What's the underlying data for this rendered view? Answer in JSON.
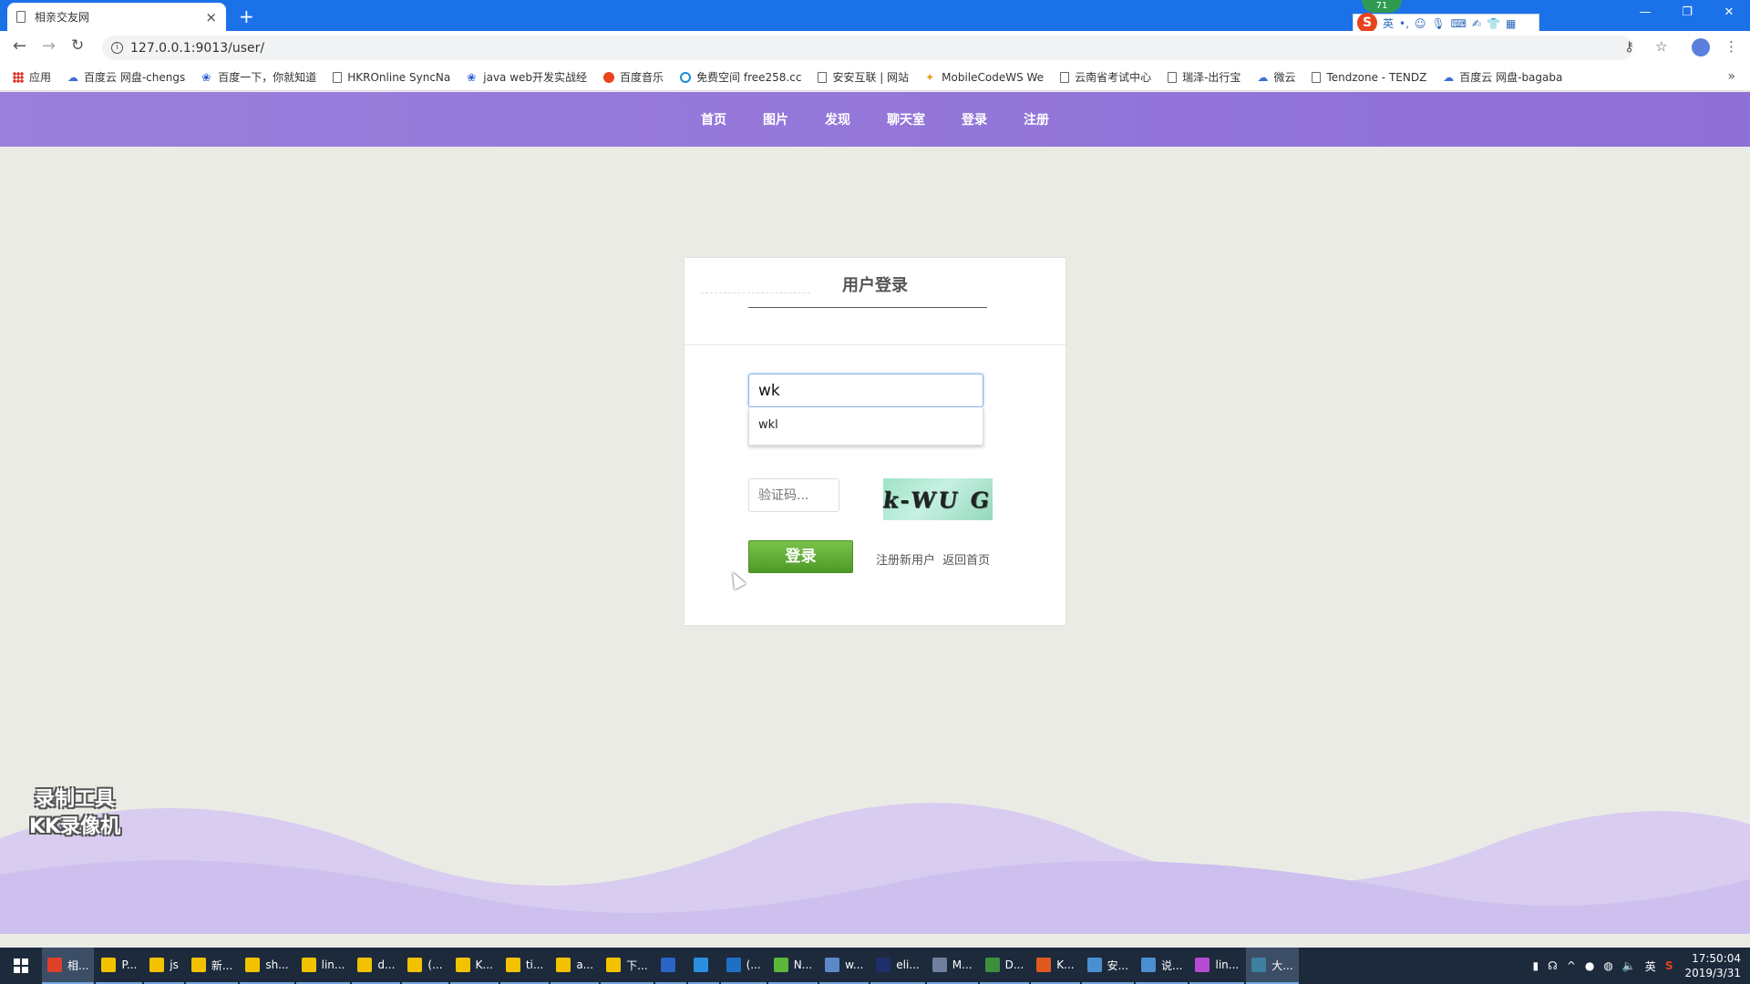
{
  "browser": {
    "tab_title": "相亲交友网",
    "tab_close": "×",
    "new_tab": "+",
    "window_controls": [
      "—",
      "❐",
      "✕"
    ],
    "url": "127.0.0.1:9013/user/",
    "ime_badge": "71",
    "ime_label": "英"
  },
  "bookmarks": [
    {
      "label": "应用",
      "icon": "apps-icon"
    },
    {
      "label": "百度云 网盘-chengs",
      "icon": "cloud-icon"
    },
    {
      "label": "百度一下，你就知道",
      "icon": "paw-icon"
    },
    {
      "label": "HKROnline SyncNa",
      "icon": "doc-icon"
    },
    {
      "label": "java web开发实战经",
      "icon": "paw-icon"
    },
    {
      "label": "百度音乐",
      "icon": "music-icon"
    },
    {
      "label": "免费空间 free258.cc",
      "icon": "globe-icon"
    },
    {
      "label": "安安互联 | 网站",
      "icon": "doc-icon"
    },
    {
      "label": "MobileCodeWS We",
      "icon": "star-icon"
    },
    {
      "label": "云南省考试中心",
      "icon": "doc-icon"
    },
    {
      "label": "瑞泽-出行宝",
      "icon": "doc-icon"
    },
    {
      "label": "微云",
      "icon": "cloud-icon"
    },
    {
      "label": "Tendzone - TENDZ",
      "icon": "doc-icon"
    },
    {
      "label": "百度云 网盘-bagaba",
      "icon": "cloud-icon"
    }
  ],
  "bookmarks_more": "»",
  "site_nav": [
    "首页",
    "图片",
    "发现",
    "聊天室",
    "登录",
    "注册"
  ],
  "login": {
    "title": "用户登录",
    "username_value": "wk",
    "suggestion": "wkl",
    "captcha_placeholder": "验证码...",
    "captcha_text": "k-WU G",
    "submit_label": "登录",
    "register_link": "注册新用户",
    "home_link": "返回首页"
  },
  "watermark": [
    "录制工具",
    "KK录像机"
  ],
  "taskbar": {
    "items": [
      {
        "label": "相...",
        "color": "#e0402a",
        "active": true
      },
      {
        "label": "P...",
        "color": "#f2c200"
      },
      {
        "label": "js",
        "color": "#f2c200"
      },
      {
        "label": "新...",
        "color": "#f2c200"
      },
      {
        "label": "sh...",
        "color": "#f2c200"
      },
      {
        "label": "lin...",
        "color": "#f2c200"
      },
      {
        "label": "d...",
        "color": "#f2c200"
      },
      {
        "label": "(...",
        "color": "#f2c200"
      },
      {
        "label": "K...",
        "color": "#f2c200"
      },
      {
        "label": "ti...",
        "color": "#f2c200"
      },
      {
        "label": "a...",
        "color": "#f2c200"
      },
      {
        "label": "下...",
        "color": "#f2c200"
      },
      {
        "label": "",
        "color": "#2a64c4"
      },
      {
        "label": "",
        "color": "#2a90e0"
      },
      {
        "label": "(...",
        "color": "#1f6fc5"
      },
      {
        "label": "N...",
        "color": "#5cb73b"
      },
      {
        "label": "w...",
        "color": "#5b88c9"
      },
      {
        "label": "eli...",
        "color": "#1f2f6b"
      },
      {
        "label": "M...",
        "color": "#6f7f9f"
      },
      {
        "label": "D...",
        "color": "#3b8f3b"
      },
      {
        "label": "K...",
        "color": "#e05a20"
      },
      {
        "label": "安...",
        "color": "#4c8fd0"
      },
      {
        "label": "说...",
        "color": "#4c8fd0"
      },
      {
        "label": "lin...",
        "color": "#b64ad0"
      },
      {
        "label": "大...",
        "color": "#3d7f9f",
        "active": true
      }
    ],
    "tray_lang": "英",
    "time": "17:50:04",
    "date": "2019/3/31"
  }
}
